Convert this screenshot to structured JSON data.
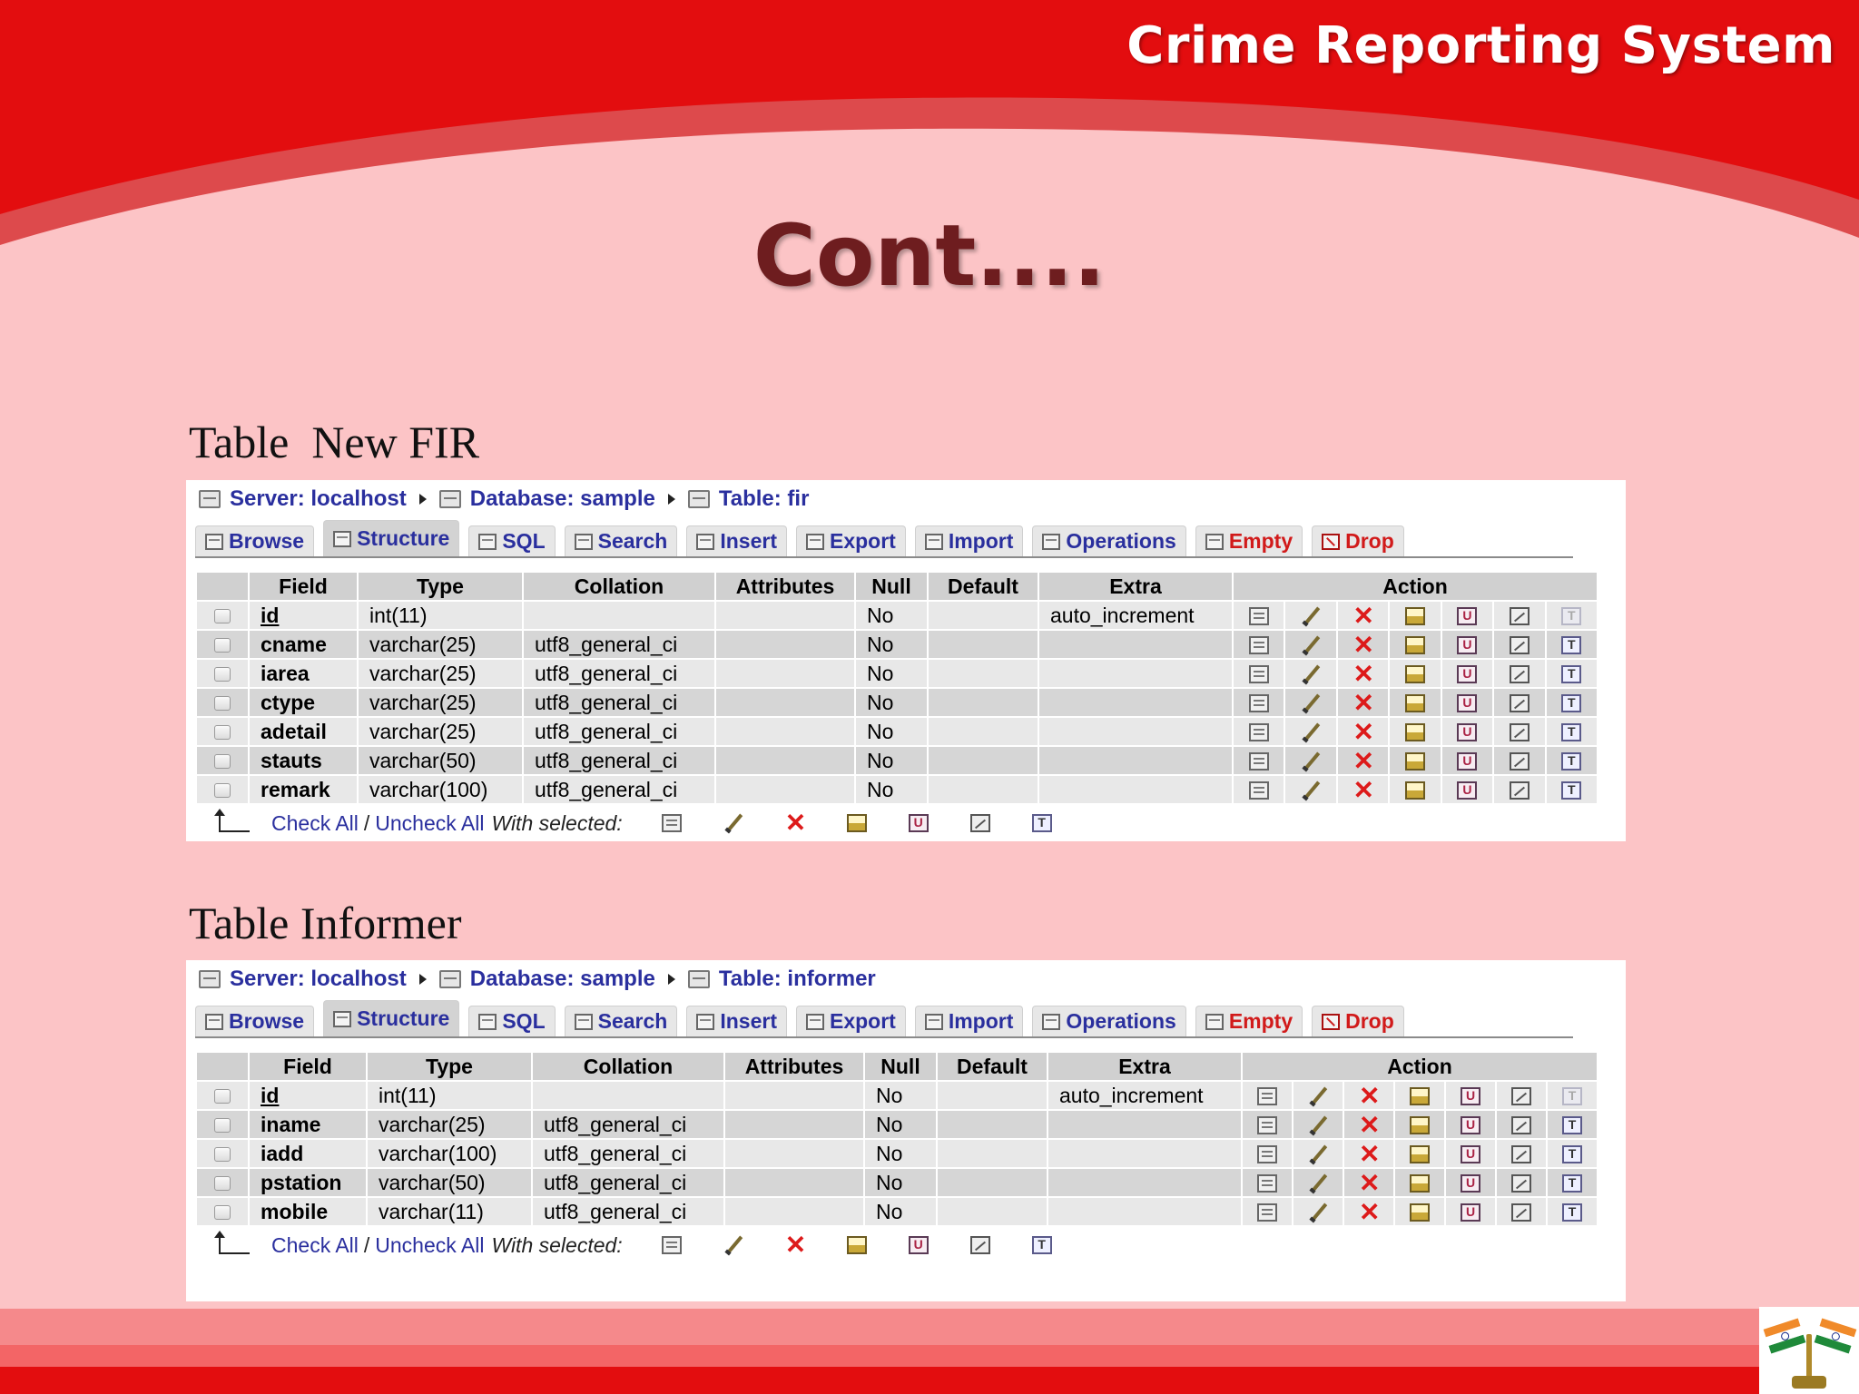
{
  "slide": {
    "brand_title": "Crime Reporting System",
    "heading": "Cont....",
    "section_fir": "Table  New FIR",
    "section_informer": "Table Informer",
    "colors": {
      "header_red": "#e30d0f",
      "background_pink": "#fcc4c6",
      "heading_maroon": "#6e1d1f"
    }
  },
  "pma_common": {
    "tabs": [
      {
        "label": "Browse",
        "icon": "browse-icon"
      },
      {
        "label": "Structure",
        "icon": "structure-icon"
      },
      {
        "label": "SQL",
        "icon": "sql-icon"
      },
      {
        "label": "Search",
        "icon": "search-icon"
      },
      {
        "label": "Insert",
        "icon": "insert-icon"
      },
      {
        "label": "Export",
        "icon": "export-icon"
      },
      {
        "label": "Import",
        "icon": "import-icon"
      },
      {
        "label": "Operations",
        "icon": "operations-icon"
      },
      {
        "label": "Empty",
        "icon": "empty-icon"
      },
      {
        "label": "Drop",
        "icon": "drop-icon"
      }
    ],
    "headers": {
      "field": "Field",
      "type": "Type",
      "collation": "Collation",
      "attributes": "Attributes",
      "null": "Null",
      "default": "Default",
      "extra": "Extra",
      "action": "Action"
    },
    "check_all": "Check All",
    "slash": "/",
    "uncheck_all": "Uncheck All",
    "with_selected": "With selected:"
  },
  "fir": {
    "server": "Server: localhost",
    "database": "Database: sample",
    "table": "Table: fir",
    "rows": [
      {
        "field": "id",
        "type": "int(11)",
        "collation": "",
        "null": "No",
        "extra": "auto_increment"
      },
      {
        "field": "cname",
        "type": "varchar(25)",
        "collation": "utf8_general_ci",
        "null": "No",
        "extra": ""
      },
      {
        "field": "iarea",
        "type": "varchar(25)",
        "collation": "utf8_general_ci",
        "null": "No",
        "extra": ""
      },
      {
        "field": "ctype",
        "type": "varchar(25)",
        "collation": "utf8_general_ci",
        "null": "No",
        "extra": ""
      },
      {
        "field": "adetail",
        "type": "varchar(25)",
        "collation": "utf8_general_ci",
        "null": "No",
        "extra": ""
      },
      {
        "field": "stauts",
        "type": "varchar(50)",
        "collation": "utf8_general_ci",
        "null": "No",
        "extra": ""
      },
      {
        "field": "remark",
        "type": "varchar(100)",
        "collation": "utf8_general_ci",
        "null": "No",
        "extra": ""
      }
    ]
  },
  "informer": {
    "server": "Server: localhost",
    "database": "Database: sample",
    "table": "Table: informer",
    "rows": [
      {
        "field": "id",
        "type": "int(11)",
        "collation": "",
        "null": "No",
        "extra": "auto_increment"
      },
      {
        "field": "iname",
        "type": "varchar(25)",
        "collation": "utf8_general_ci",
        "null": "No",
        "extra": ""
      },
      {
        "field": "iadd",
        "type": "varchar(100)",
        "collation": "utf8_general_ci",
        "null": "No",
        "extra": ""
      },
      {
        "field": "pstation",
        "type": "varchar(50)",
        "collation": "utf8_general_ci",
        "null": "No",
        "extra": ""
      },
      {
        "field": "mobile",
        "type": "varchar(11)",
        "collation": "utf8_general_ci",
        "null": "No",
        "extra": ""
      }
    ]
  }
}
